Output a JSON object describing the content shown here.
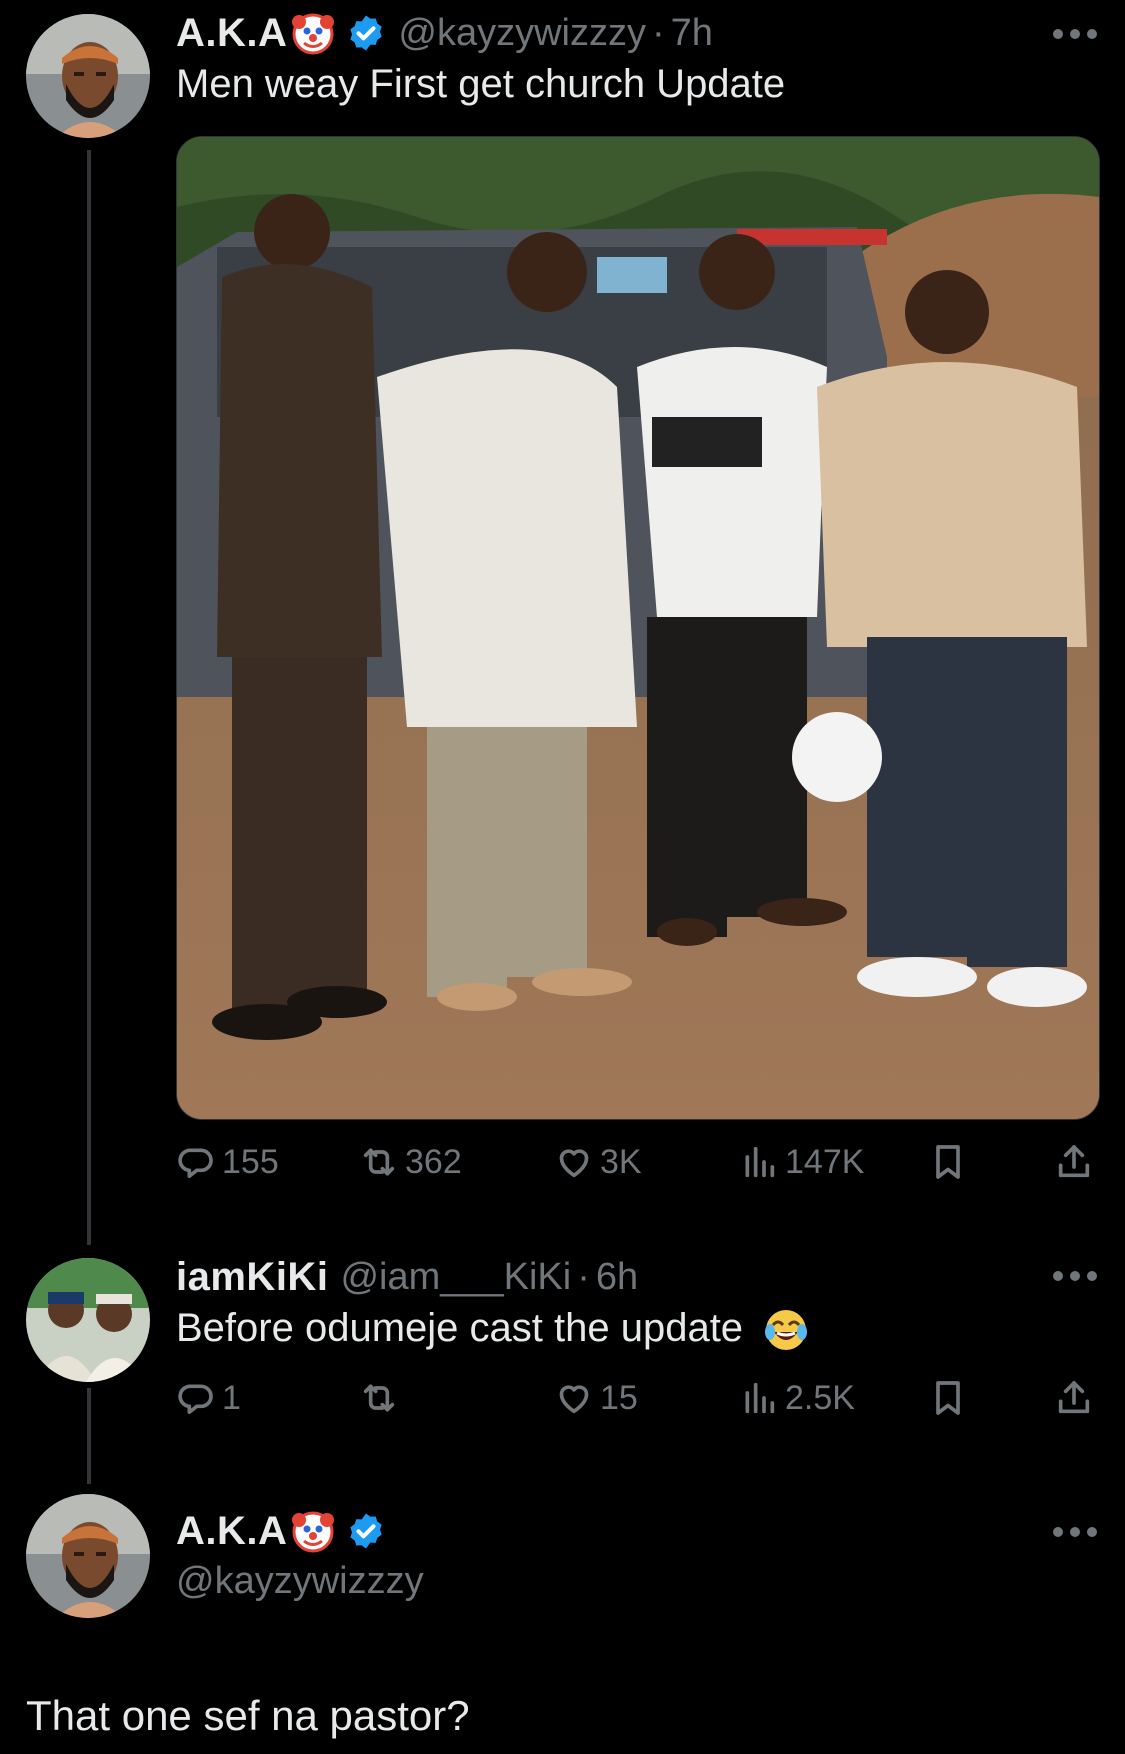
{
  "tweets": [
    {
      "name": "A.K.A",
      "handle": "@kayzywizzzy",
      "separator": "·",
      "time": "7h",
      "text": "Men weay First get church Update",
      "stats": {
        "replies": "155",
        "retweets": "362",
        "likes": "3K",
        "views": "147K"
      }
    },
    {
      "name": "iamKiKi",
      "handle": "@iam___KiKi",
      "separator": "·",
      "time": "6h",
      "text": "Before odumeje cast the update",
      "stats": {
        "replies": "1",
        "retweets": "",
        "likes": "15",
        "views": "2.5K"
      }
    },
    {
      "name": "A.K.A",
      "handle": "@kayzywizzzy",
      "text": "That one sef na pastor?"
    }
  ],
  "colors": {
    "background": "#000000",
    "text": "#e7e9ea",
    "muted": "#71767b",
    "verified": "#1d9bf0"
  },
  "icons": [
    "clown-emoji",
    "verified-badge-icon",
    "more-icon",
    "reply-icon",
    "retweet-icon",
    "like-icon",
    "views-icon",
    "bookmark-icon",
    "share-icon",
    "laughing-emoji"
  ]
}
